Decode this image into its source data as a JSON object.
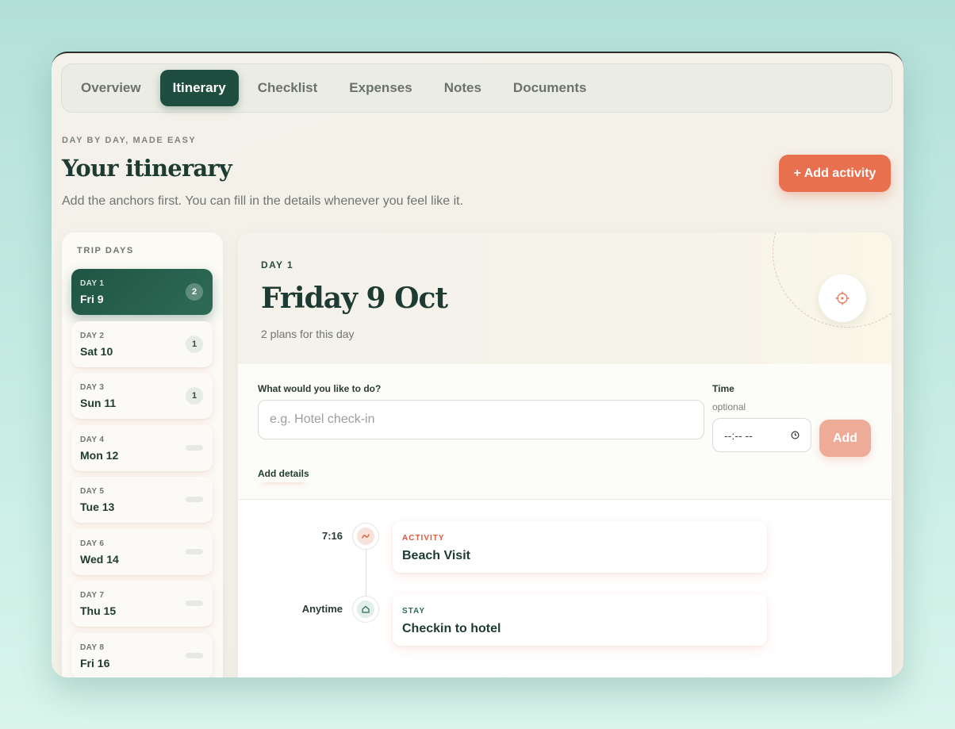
{
  "tabs": [
    {
      "label": "Overview",
      "active": false
    },
    {
      "label": "Itinerary",
      "active": true
    },
    {
      "label": "Checklist",
      "active": false
    },
    {
      "label": "Expenses",
      "active": false
    },
    {
      "label": "Notes",
      "active": false
    },
    {
      "label": "Documents",
      "active": false
    }
  ],
  "header": {
    "eyebrow": "DAY BY DAY, MADE EASY",
    "title": "Your itinerary",
    "subtitle": "Add the anchors first. You can fill in the details whenever you feel like it.",
    "add_activity_label": "+ Add activity"
  },
  "sidebar": {
    "heading": "TRIP DAYS",
    "days": [
      {
        "label": "DAY 1",
        "date": "Fri 9",
        "count": "2",
        "active": true
      },
      {
        "label": "DAY 2",
        "date": "Sat 10",
        "count": "1",
        "active": false
      },
      {
        "label": "DAY 3",
        "date": "Sun 11",
        "count": "1",
        "active": false
      },
      {
        "label": "DAY 4",
        "date": "Mon 12",
        "count": "",
        "active": false
      },
      {
        "label": "DAY 5",
        "date": "Tue 13",
        "count": "",
        "active": false
      },
      {
        "label": "DAY 6",
        "date": "Wed 14",
        "count": "",
        "active": false
      },
      {
        "label": "DAY 7",
        "date": "Thu 15",
        "count": "",
        "active": false
      },
      {
        "label": "DAY 8",
        "date": "Fri 16",
        "count": "",
        "active": false
      }
    ]
  },
  "day": {
    "kicker": "DAY 1",
    "title": "Friday 9 Oct",
    "subtitle": "2 plans for this day"
  },
  "form": {
    "what_label": "What would you like to do?",
    "what_placeholder": "e.g. Hotel check-in",
    "time_label": "Time",
    "time_optional": "optional",
    "time_value": "--:-- --",
    "add_label": "Add",
    "add_details_label": "Add details"
  },
  "timeline": [
    {
      "time": "7:16",
      "category": "ACTIVITY",
      "title": "Beach Visit",
      "icon": "sparkle-icon"
    },
    {
      "time": "Anytime",
      "category": "STAY",
      "title": "Checkin to hotel",
      "icon": "home-icon"
    }
  ],
  "colors": {
    "brand_green": "#1f4d40",
    "accent_coral": "#e9704f",
    "activity_red": "#dc5a3c",
    "stay_green": "#2f6a54"
  }
}
